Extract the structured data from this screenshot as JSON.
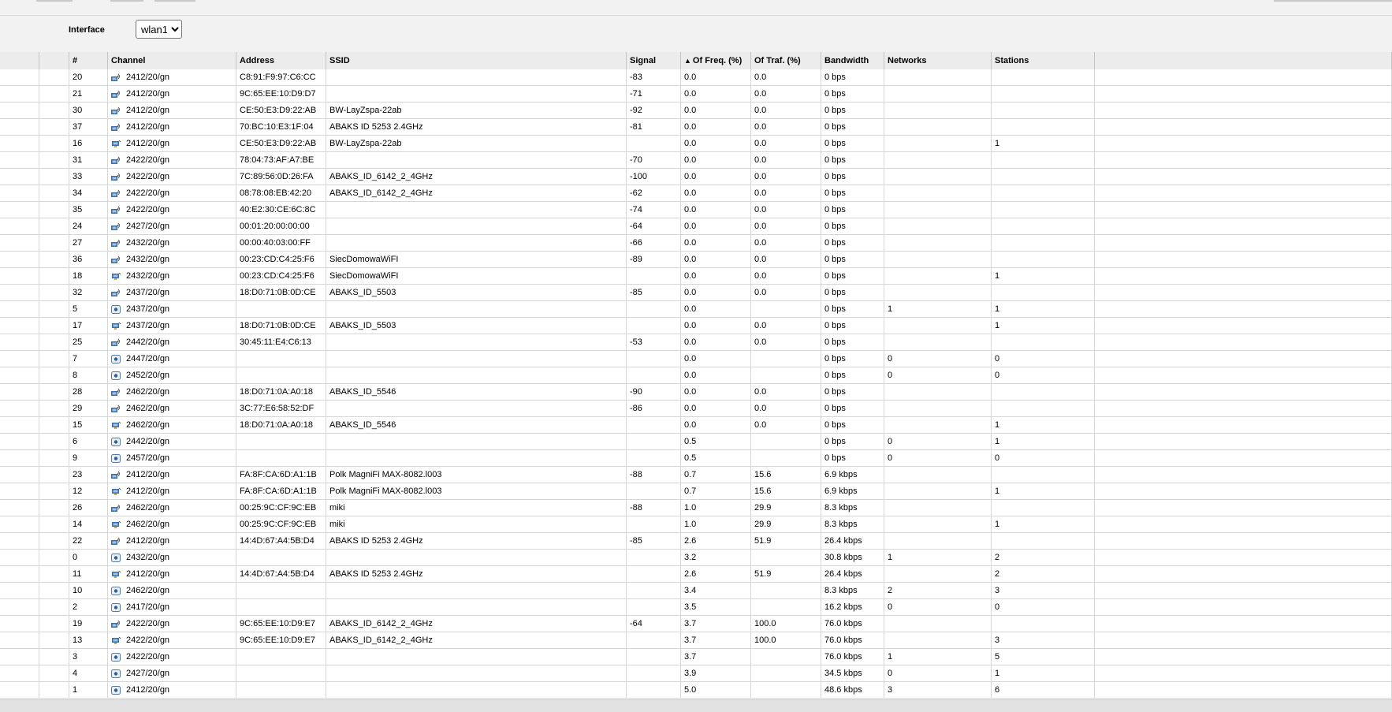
{
  "toolbar": {
    "interface_label": "Interface",
    "interface_value": "wlan1"
  },
  "columns": [
    "",
    "",
    "#",
    "Channel",
    "Address",
    "SSID",
    "Signal",
    "Of Freq. (%)",
    "Of Traf. (%)",
    "Bandwidth",
    "Networks",
    "Stations",
    ""
  ],
  "sort": {
    "column": "Of Freq. (%)",
    "direction": "ascending",
    "indicator": "▲"
  },
  "icon_names": {
    "ap": "access-point-icon",
    "station": "station-icon",
    "channel": "channel-icon"
  },
  "rows": [
    {
      "num": "20",
      "icon": "ap",
      "channel": "2412/20/gn",
      "address": "C8:91:F9:97:C6:CC",
      "ssid": "",
      "signal": "-83",
      "freq": "0.0",
      "traf": "0.0",
      "bw": "0 bps",
      "networks": "",
      "stations": ""
    },
    {
      "num": "21",
      "icon": "ap",
      "channel": "2412/20/gn",
      "address": "9C:65:EE:10:D9:D7",
      "ssid": "",
      "signal": "-71",
      "freq": "0.0",
      "traf": "0.0",
      "bw": "0 bps",
      "networks": "",
      "stations": ""
    },
    {
      "num": "30",
      "icon": "ap",
      "channel": "2412/20/gn",
      "address": "CE:50:E3:D9:22:AB",
      "ssid": "BW-LayZspa-22ab",
      "signal": "-92",
      "freq": "0.0",
      "traf": "0.0",
      "bw": "0 bps",
      "networks": "",
      "stations": ""
    },
    {
      "num": "37",
      "icon": "ap",
      "channel": "2412/20/gn",
      "address": "70:BC:10:E3:1F:04",
      "ssid": "ABAKS ID 5253 2.4GHz",
      "signal": "-81",
      "freq": "0.0",
      "traf": "0.0",
      "bw": "0 bps",
      "networks": "",
      "stations": ""
    },
    {
      "num": "16",
      "icon": "station",
      "channel": "2412/20/gn",
      "address": "CE:50:E3:D9:22:AB",
      "ssid": "BW-LayZspa-22ab",
      "signal": "",
      "freq": "0.0",
      "traf": "0.0",
      "bw": "0 bps",
      "networks": "",
      "stations": "1"
    },
    {
      "num": "31",
      "icon": "ap",
      "channel": "2422/20/gn",
      "address": "78:04:73:AF:A7:BE",
      "ssid": "",
      "signal": "-70",
      "freq": "0.0",
      "traf": "0.0",
      "bw": "0 bps",
      "networks": "",
      "stations": ""
    },
    {
      "num": "33",
      "icon": "ap",
      "channel": "2422/20/gn",
      "address": "7C:89:56:0D:26:FA",
      "ssid": "ABAKS_ID_6142_2_4GHz",
      "signal": "-100",
      "freq": "0.0",
      "traf": "0.0",
      "bw": "0 bps",
      "networks": "",
      "stations": ""
    },
    {
      "num": "34",
      "icon": "ap",
      "channel": "2422/20/gn",
      "address": "08:78:08:EB:42:20",
      "ssid": "ABAKS_ID_6142_2_4GHz",
      "signal": "-62",
      "freq": "0.0",
      "traf": "0.0",
      "bw": "0 bps",
      "networks": "",
      "stations": ""
    },
    {
      "num": "35",
      "icon": "ap",
      "channel": "2422/20/gn",
      "address": "40:E2:30:CE:6C:8C",
      "ssid": "",
      "signal": "-74",
      "freq": "0.0",
      "traf": "0.0",
      "bw": "0 bps",
      "networks": "",
      "stations": ""
    },
    {
      "num": "24",
      "icon": "ap",
      "channel": "2427/20/gn",
      "address": "00:01:20:00:00:00",
      "ssid": "",
      "signal": "-64",
      "freq": "0.0",
      "traf": "0.0",
      "bw": "0 bps",
      "networks": "",
      "stations": ""
    },
    {
      "num": "27",
      "icon": "ap",
      "channel": "2432/20/gn",
      "address": "00:00:40:03:00:FF",
      "ssid": "",
      "signal": "-66",
      "freq": "0.0",
      "traf": "0.0",
      "bw": "0 bps",
      "networks": "",
      "stations": ""
    },
    {
      "num": "36",
      "icon": "ap",
      "channel": "2432/20/gn",
      "address": "00:23:CD:C4:25:F6",
      "ssid": "SiecDomowaWiFI",
      "signal": "-89",
      "freq": "0.0",
      "traf": "0.0",
      "bw": "0 bps",
      "networks": "",
      "stations": ""
    },
    {
      "num": "18",
      "icon": "station",
      "channel": "2432/20/gn",
      "address": "00:23:CD:C4:25:F6",
      "ssid": "SiecDomowaWiFI",
      "signal": "",
      "freq": "0.0",
      "traf": "0.0",
      "bw": "0 bps",
      "networks": "",
      "stations": "1"
    },
    {
      "num": "32",
      "icon": "ap",
      "channel": "2437/20/gn",
      "address": "18:D0:71:0B:0D:CE",
      "ssid": "ABAKS_ID_5503",
      "signal": "-85",
      "freq": "0.0",
      "traf": "0.0",
      "bw": "0 bps",
      "networks": "",
      "stations": ""
    },
    {
      "num": "5",
      "icon": "channel",
      "channel": "2437/20/gn",
      "address": "",
      "ssid": "",
      "signal": "",
      "freq": "0.0",
      "traf": "",
      "bw": "0 bps",
      "networks": "1",
      "stations": "1"
    },
    {
      "num": "17",
      "icon": "station",
      "channel": "2437/20/gn",
      "address": "18:D0:71:0B:0D:CE",
      "ssid": "ABAKS_ID_5503",
      "signal": "",
      "freq": "0.0",
      "traf": "0.0",
      "bw": "0 bps",
      "networks": "",
      "stations": "1"
    },
    {
      "num": "25",
      "icon": "ap",
      "channel": "2442/20/gn",
      "address": "30:45:11:E4:C6:13",
      "ssid": "",
      "signal": "-53",
      "freq": "0.0",
      "traf": "0.0",
      "bw": "0 bps",
      "networks": "",
      "stations": ""
    },
    {
      "num": "7",
      "icon": "channel",
      "channel": "2447/20/gn",
      "address": "",
      "ssid": "",
      "signal": "",
      "freq": "0.0",
      "traf": "",
      "bw": "0 bps",
      "networks": "0",
      "stations": "0"
    },
    {
      "num": "8",
      "icon": "channel",
      "channel": "2452/20/gn",
      "address": "",
      "ssid": "",
      "signal": "",
      "freq": "0.0",
      "traf": "",
      "bw": "0 bps",
      "networks": "0",
      "stations": "0"
    },
    {
      "num": "28",
      "icon": "ap",
      "channel": "2462/20/gn",
      "address": "18:D0:71:0A:A0:18",
      "ssid": "ABAKS_ID_5546",
      "signal": "-90",
      "freq": "0.0",
      "traf": "0.0",
      "bw": "0 bps",
      "networks": "",
      "stations": ""
    },
    {
      "num": "29",
      "icon": "ap",
      "channel": "2462/20/gn",
      "address": "3C:77:E6:58:52:DF",
      "ssid": "",
      "signal": "-86",
      "freq": "0.0",
      "traf": "0.0",
      "bw": "0 bps",
      "networks": "",
      "stations": ""
    },
    {
      "num": "15",
      "icon": "station",
      "channel": "2462/20/gn",
      "address": "18:D0:71:0A:A0:18",
      "ssid": "ABAKS_ID_5546",
      "signal": "",
      "freq": "0.0",
      "traf": "0.0",
      "bw": "0 bps",
      "networks": "",
      "stations": "1"
    },
    {
      "num": "6",
      "icon": "channel",
      "channel": "2442/20/gn",
      "address": "",
      "ssid": "",
      "signal": "",
      "freq": "0.5",
      "traf": "",
      "bw": "0 bps",
      "networks": "0",
      "stations": "1"
    },
    {
      "num": "9",
      "icon": "channel",
      "channel": "2457/20/gn",
      "address": "",
      "ssid": "",
      "signal": "",
      "freq": "0.5",
      "traf": "",
      "bw": "0 bps",
      "networks": "0",
      "stations": "0"
    },
    {
      "num": "23",
      "icon": "ap",
      "channel": "2412/20/gn",
      "address": "FA:8F:CA:6D:A1:1B",
      "ssid": "Polk MagniFi MAX-8082.l003",
      "signal": "-88",
      "freq": "0.7",
      "traf": "15.6",
      "bw": "6.9 kbps",
      "networks": "",
      "stations": ""
    },
    {
      "num": "12",
      "icon": "station",
      "channel": "2412/20/gn",
      "address": "FA:8F:CA:6D:A1:1B",
      "ssid": "Polk MagniFi MAX-8082.l003",
      "signal": "",
      "freq": "0.7",
      "traf": "15.6",
      "bw": "6.9 kbps",
      "networks": "",
      "stations": "1"
    },
    {
      "num": "26",
      "icon": "ap",
      "channel": "2462/20/gn",
      "address": "00:25:9C:CF:9C:EB",
      "ssid": "miki",
      "signal": "-88",
      "freq": "1.0",
      "traf": "29.9",
      "bw": "8.3 kbps",
      "networks": "",
      "stations": ""
    },
    {
      "num": "14",
      "icon": "station",
      "channel": "2462/20/gn",
      "address": "00:25:9C:CF:9C:EB",
      "ssid": "miki",
      "signal": "",
      "freq": "1.0",
      "traf": "29.9",
      "bw": "8.3 kbps",
      "networks": "",
      "stations": "1"
    },
    {
      "num": "22",
      "icon": "ap",
      "channel": "2412/20/gn",
      "address": "14:4D:67:A4:5B:D4",
      "ssid": "ABAKS ID 5253 2.4GHz",
      "signal": "-85",
      "freq": "2.6",
      "traf": "51.9",
      "bw": "26.4 kbps",
      "networks": "",
      "stations": ""
    },
    {
      "num": "0",
      "icon": "channel",
      "channel": "2432/20/gn",
      "address": "",
      "ssid": "",
      "signal": "",
      "freq": "3.2",
      "traf": "",
      "bw": "30.8 kbps",
      "networks": "1",
      "stations": "2"
    },
    {
      "num": "11",
      "icon": "station",
      "channel": "2412/20/gn",
      "address": "14:4D:67:A4:5B:D4",
      "ssid": "ABAKS ID 5253 2.4GHz",
      "signal": "",
      "freq": "2.6",
      "traf": "51.9",
      "bw": "26.4 kbps",
      "networks": "",
      "stations": "2"
    },
    {
      "num": "10",
      "icon": "channel",
      "channel": "2462/20/gn",
      "address": "",
      "ssid": "",
      "signal": "",
      "freq": "3.4",
      "traf": "",
      "bw": "8.3 kbps",
      "networks": "2",
      "stations": "3"
    },
    {
      "num": "2",
      "icon": "channel",
      "channel": "2417/20/gn",
      "address": "",
      "ssid": "",
      "signal": "",
      "freq": "3.5",
      "traf": "",
      "bw": "16.2 kbps",
      "networks": "0",
      "stations": "0"
    },
    {
      "num": "19",
      "icon": "ap",
      "channel": "2422/20/gn",
      "address": "9C:65:EE:10:D9:E7",
      "ssid": "ABAKS_ID_6142_2_4GHz",
      "signal": "-64",
      "freq": "3.7",
      "traf": "100.0",
      "bw": "76.0 kbps",
      "networks": "",
      "stations": ""
    },
    {
      "num": "13",
      "icon": "station",
      "channel": "2422/20/gn",
      "address": "9C:65:EE:10:D9:E7",
      "ssid": "ABAKS_ID_6142_2_4GHz",
      "signal": "",
      "freq": "3.7",
      "traf": "100.0",
      "bw": "76.0 kbps",
      "networks": "",
      "stations": "3"
    },
    {
      "num": "3",
      "icon": "channel",
      "channel": "2422/20/gn",
      "address": "",
      "ssid": "",
      "signal": "",
      "freq": "3.7",
      "traf": "",
      "bw": "76.0 kbps",
      "networks": "1",
      "stations": "5"
    },
    {
      "num": "4",
      "icon": "channel",
      "channel": "2427/20/gn",
      "address": "",
      "ssid": "",
      "signal": "",
      "freq": "3.9",
      "traf": "",
      "bw": "34.5 kbps",
      "networks": "0",
      "stations": "1"
    },
    {
      "num": "1",
      "icon": "channel",
      "channel": "2412/20/gn",
      "address": "",
      "ssid": "",
      "signal": "",
      "freq": "5.0",
      "traf": "",
      "bw": "48.6 kbps",
      "networks": "3",
      "stations": "6"
    }
  ]
}
